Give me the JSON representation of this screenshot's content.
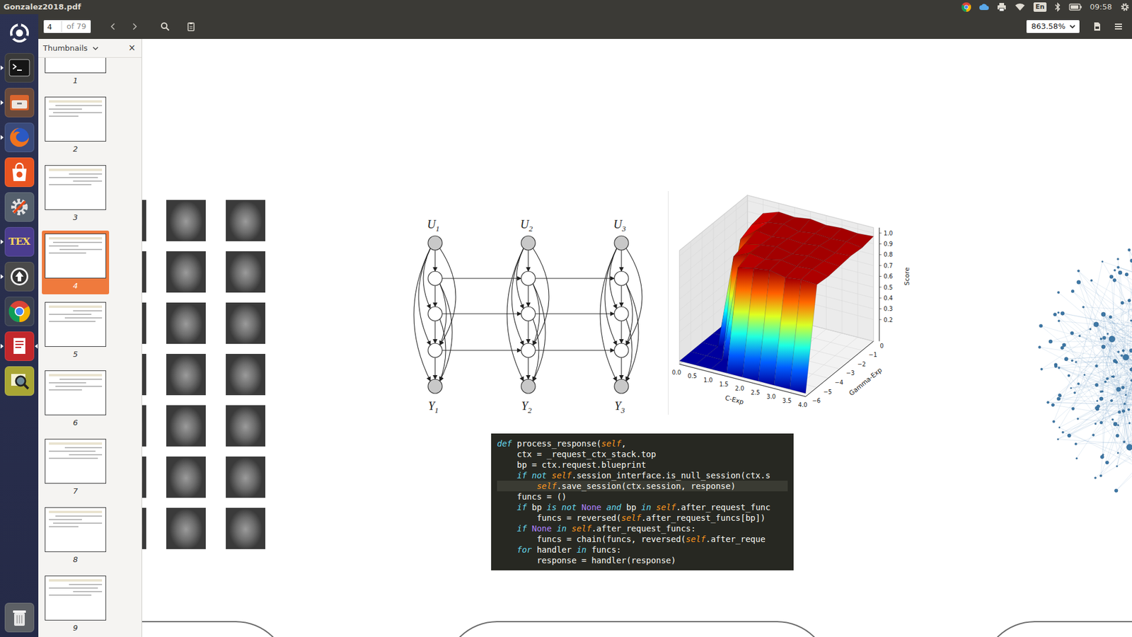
{
  "window": {
    "title": "Gonzalez2018.pdf"
  },
  "panel": {
    "keyboard": "En",
    "clock": "09:58"
  },
  "launcher": {
    "items": [
      {
        "kind": "dash",
        "running": false,
        "focused": false
      },
      {
        "kind": "terminal",
        "running": true,
        "focused": false
      },
      {
        "kind": "files",
        "running": true,
        "focused": false
      },
      {
        "kind": "firefox",
        "running": true,
        "focused": false
      },
      {
        "kind": "software",
        "running": false,
        "focused": false
      },
      {
        "kind": "settings",
        "running": false,
        "focused": false
      },
      {
        "kind": "tex",
        "text": "TEX",
        "running": true,
        "focused": false
      },
      {
        "kind": "updater",
        "running": true,
        "focused": false
      },
      {
        "kind": "chrome",
        "running": false,
        "focused": false
      },
      {
        "kind": "docviewer",
        "running": true,
        "focused": true
      },
      {
        "kind": "imageviewer",
        "running": false,
        "focused": false
      },
      {
        "kind": "trash",
        "running": false,
        "focused": false
      }
    ]
  },
  "toolbar": {
    "page": "4",
    "page_count": "of 79",
    "zoom": "863.58%"
  },
  "sidebar": {
    "title": "Thumbnails",
    "close": "×",
    "pages": [
      {
        "label": "1",
        "selected": false
      },
      {
        "label": "2",
        "selected": false
      },
      {
        "label": "3",
        "selected": false
      },
      {
        "label": "4",
        "selected": true
      },
      {
        "label": "5",
        "selected": false
      },
      {
        "label": "6",
        "selected": false
      },
      {
        "label": "7",
        "selected": false
      },
      {
        "label": "8",
        "selected": false
      },
      {
        "label": "9",
        "selected": false
      }
    ]
  },
  "document": {
    "diagram": {
      "columns": [
        {
          "input": "U",
          "input_sub": "1",
          "output": "Y",
          "output_sub": "1"
        },
        {
          "input": "U",
          "input_sub": "2",
          "output": "Y",
          "output_sub": "2"
        },
        {
          "input": "U",
          "input_sub": "3",
          "output": "Y",
          "output_sub": "3"
        }
      ]
    },
    "plot": {
      "x_label": "C-Exp",
      "y_label": "Gamma-Exp",
      "z_label": "Score",
      "x_ticks": [
        "0.0",
        "0.5",
        "1.0",
        "1.5",
        "2.0",
        "2.5",
        "3.0",
        "3.5",
        "4.0"
      ],
      "y_ticks": [
        "0",
        "−1",
        "−2",
        "−3",
        "−4",
        "−5",
        "−6"
      ],
      "z_ticks": [
        "0.2",
        "0.3",
        "0.4",
        "0.5",
        "0.6",
        "0.7",
        "0.8",
        "0.9",
        "1.0"
      ],
      "x_values": [
        0,
        0.5,
        1,
        1.5,
        2,
        2.5,
        3,
        3.5,
        4
      ],
      "y_values": [
        -6,
        -5,
        -4,
        -3,
        -2,
        -1,
        0
      ],
      "scores": [
        [
          0.03,
          0.03,
          0.03,
          0.03,
          0.03,
          0.03,
          0.03,
          0.03,
          0.03
        ],
        [
          0.03,
          0.03,
          0.03,
          0.92,
          0.95,
          0.97,
          0.94,
          0.96,
          0.95
        ],
        [
          0.03,
          0.03,
          0.9,
          0.97,
          0.95,
          0.98,
          0.96,
          0.97,
          0.94
        ],
        [
          0.03,
          0.03,
          0.93,
          0.96,
          0.98,
          0.95,
          0.97,
          0.96,
          0.95
        ],
        [
          0.03,
          0.85,
          0.97,
          0.95,
          0.97,
          0.96,
          0.98,
          0.95,
          0.96
        ],
        [
          0.03,
          0.9,
          0.96,
          0.98,
          0.95,
          0.97,
          0.96,
          0.97,
          0.95
        ],
        [
          0.03,
          0.92,
          0.97,
          0.96,
          0.98,
          0.96,
          0.97,
          0.96,
          0.97
        ]
      ]
    },
    "code": {
      "lines": [
        {
          "text": "def process_response(self,",
          "selected": false
        },
        {
          "text": "    ctx = _request_ctx_stack.top",
          "selected": false
        },
        {
          "text": "    bp = ctx.request.blueprint",
          "selected": false
        },
        {
          "text": "    if not self.session_interface.is_null_session(ctx.s",
          "selected": false
        },
        {
          "text": "        self.save_session(ctx.session, response)",
          "selected": true
        },
        {
          "text": "    funcs = ()",
          "selected": false
        },
        {
          "text": "    if bp is not None and bp in self.after_request_func",
          "selected": false
        },
        {
          "text": "        funcs = reversed(self.after_request_funcs[bp])",
          "selected": false
        },
        {
          "text": "    if None in self.after_request_funcs:",
          "selected": false
        },
        {
          "text": "        funcs = chain(funcs, reversed(self.after_reque",
          "selected": false
        },
        {
          "text": "    for handler in funcs:",
          "selected": false
        },
        {
          "text": "        response = handler(response)",
          "selected": false
        }
      ]
    }
  }
}
